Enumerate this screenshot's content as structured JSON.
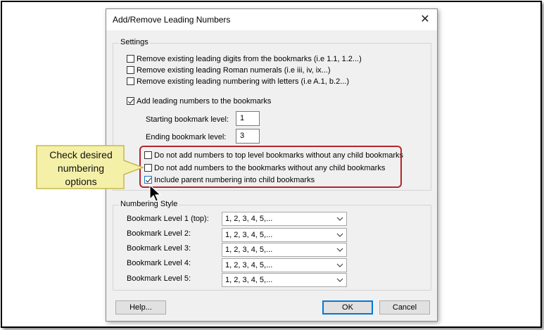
{
  "dialog": {
    "title": "Add/Remove Leading Numbers",
    "close_glyph": "✕"
  },
  "settings": {
    "label": "Settings",
    "remove_digits": {
      "label": "Remove existing leading digits from the bookmarks (i.e 1.1, 1.2...)",
      "checked": false
    },
    "remove_roman": {
      "label": "Remove existing leading Roman numerals (i.e iii, iv, ix...)",
      "checked": false
    },
    "remove_letters": {
      "label": "Remove existing leading numbering with letters (i.e A.1, b.2...)",
      "checked": false
    },
    "add_numbers": {
      "label": "Add leading numbers to the bookmarks",
      "checked": true
    },
    "starting_level": {
      "label": "Starting bookmark level:",
      "value": "1"
    },
    "ending_level": {
      "label": "Ending bookmark level:",
      "value": "3"
    },
    "no_top_level": {
      "label": "Do not add numbers to top level bookmarks without any child bookmarks",
      "checked": false
    },
    "no_childless": {
      "label": "Do not add numbers to the bookmarks without any child bookmarks",
      "checked": false
    },
    "include_parent": {
      "label": "Include parent numbering into child bookmarks",
      "checked": true
    }
  },
  "numbering_style": {
    "label": "Numbering Style",
    "levels": [
      {
        "label": "Bookmark Level 1 (top):",
        "value": "1, 2, 3, 4, 5,..."
      },
      {
        "label": "Bookmark Level 2:",
        "value": "1, 2, 3, 4, 5,..."
      },
      {
        "label": "Bookmark Level 3:",
        "value": "1, 2, 3, 4, 5,..."
      },
      {
        "label": "Bookmark Level 4:",
        "value": "1, 2, 3, 4, 5,..."
      },
      {
        "label": "Bookmark Level 5:",
        "value": "1, 2, 3, 4, 5,..."
      }
    ]
  },
  "buttons": {
    "help": "Help...",
    "ok": "OK",
    "cancel": "Cancel"
  },
  "callout": {
    "line1": "Check desired",
    "line2": "numbering",
    "line3": "options",
    "fill_color": "#f4f0a8",
    "border_color": "#c8b84a",
    "highlight_color": "#b3262e"
  }
}
